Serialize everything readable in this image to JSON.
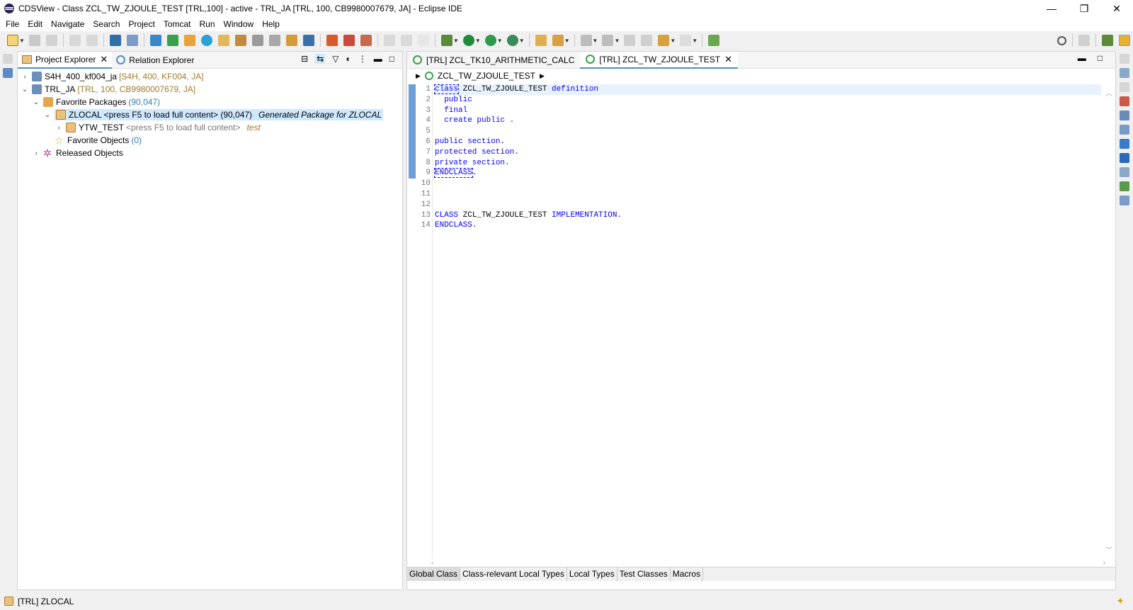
{
  "window": {
    "title": "CDSView - Class ZCL_TW_ZJOULE_TEST [TRL,100] - active - TRL_JA [TRL, 100, CB9980007679, JA] - Eclipse IDE",
    "minimize": "—",
    "restore": "❐",
    "close": "✕"
  },
  "menu": [
    "File",
    "Edit",
    "Navigate",
    "Search",
    "Project",
    "Tomcat",
    "Run",
    "Window",
    "Help"
  ],
  "explorer": {
    "tab_project": "Project Explorer",
    "tab_relation": "Relation Explorer",
    "tree": {
      "s4h": {
        "name": "S4H_400_kf004_ja",
        "deco": "[S4H, 400, KF004, JA]"
      },
      "trl": {
        "name": "TRL_JA",
        "deco": "[TRL, 100, CB9980007679, JA]"
      },
      "fav_packages": {
        "name": "Favorite Packages",
        "count": "(90,047)"
      },
      "zlocal": {
        "name": "ZLOCAL <press F5 to load full content> (90,047)",
        "desc": "Generated Package for ZLOCAL"
      },
      "ytw": {
        "name": "YTW_TEST",
        "gray": "<press F5 to load full content>",
        "desc": "test"
      },
      "fav_objects": {
        "name": "Favorite Objects",
        "count": "(0)"
      },
      "released": {
        "name": "Released Objects"
      }
    }
  },
  "editor": {
    "tab1": "[TRL] ZCL_TK10_ARITHMETIC_CALC",
    "tab2": "[TRL] ZCL_TW_ZJOULE_TEST",
    "breadcrumb": "ZCL_TW_ZJOULE_TEST",
    "line_numbers": [
      "1",
      "2",
      "3",
      "4",
      "5",
      "6",
      "7",
      "8",
      "9",
      "10",
      "11",
      "12",
      "13",
      "14"
    ],
    "code": {
      "l1_kw": "class",
      "l1_name": " ZCL_TW_ZJOULE_TEST ",
      "l1_def": "definition",
      "l2": "  public",
      "l3": "  final",
      "l4": "  create public .",
      "l6": "public section.",
      "l7": "protected section.",
      "l8": "private section.",
      "l9_kw": "ENDCLASS",
      "l9_dot": ".",
      "l13_kw": "CLASS",
      "l13_name": " ZCL_TW_ZJOULE_TEST ",
      "l13_impl": "IMPLEMENTATION.",
      "l14": "ENDCLASS."
    },
    "bottom_tabs": [
      "Global Class",
      "Class-relevant Local Types",
      "Local Types",
      "Test Classes",
      "Macros"
    ]
  },
  "status": {
    "text": "[TRL] ZLOCAL"
  },
  "colors": {
    "accent": "#4a90d9",
    "keyword": "#0000ff",
    "selection": "#cde8ff"
  }
}
